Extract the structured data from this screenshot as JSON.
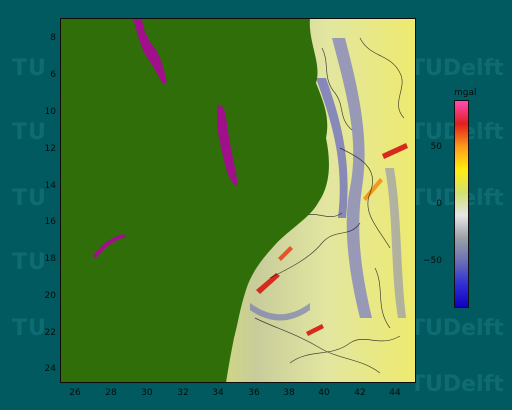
{
  "map": {
    "y_axis_labels": [
      "8",
      "6",
      "10",
      "12",
      "14",
      "16",
      "18",
      "20",
      "22",
      "24"
    ],
    "x_axis_labels": [
      "26",
      "28",
      "30",
      "32",
      "34",
      "36",
      "38",
      "40",
      "42",
      "44"
    ],
    "land_color": "#2f6e08",
    "lake_color": "#a0108a",
    "background_color": "#005a5f"
  },
  "colorbar": {
    "unit": "mgal",
    "labels": [
      "50",
      "0",
      "−50"
    ],
    "colors": [
      "#ff4ab8",
      "#e0201f",
      "#ff9a1a",
      "#ffee10",
      "#d2e070",
      "#e6e6e6",
      "#9aa0a8",
      "#6b6fb5",
      "#2f2fd6",
      "#1000c0"
    ]
  },
  "watermark": {
    "tu_text": "TU",
    "delft_text": "TUDelft"
  }
}
